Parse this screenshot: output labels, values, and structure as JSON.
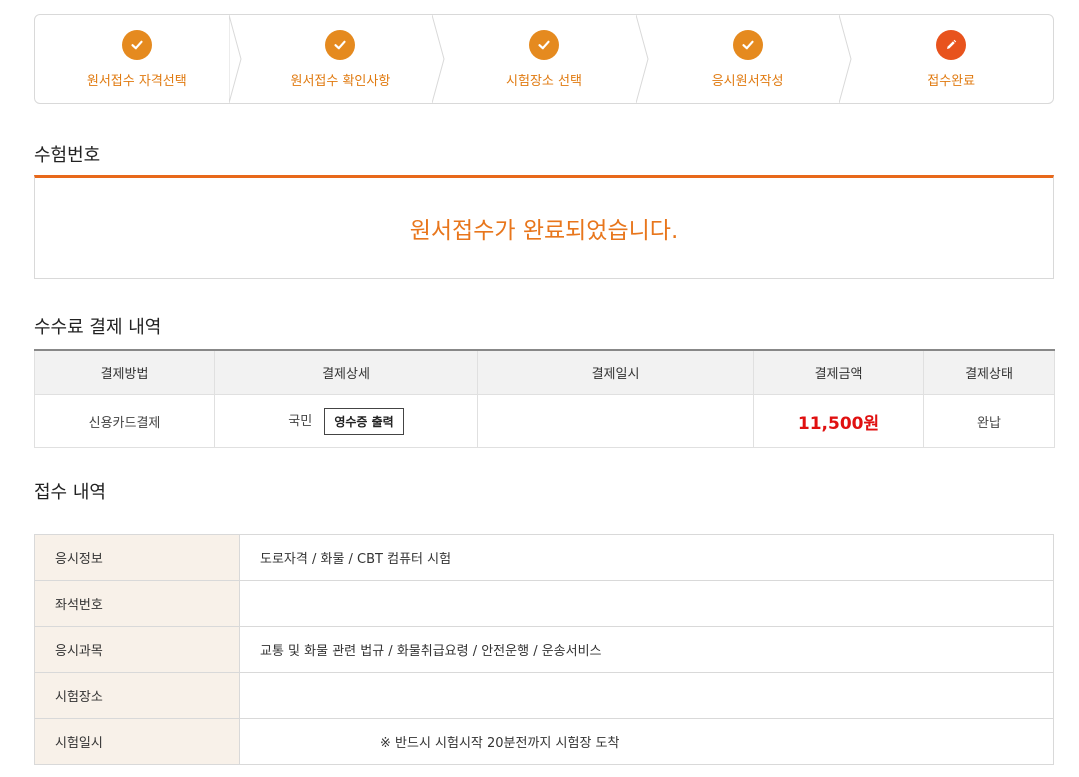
{
  "stepper": {
    "steps": [
      {
        "label": "원서접수 자격선택",
        "icon": "check-icon"
      },
      {
        "label": "원서접수 확인사항",
        "icon": "check-icon"
      },
      {
        "label": "시험장소 선택",
        "icon": "check-icon"
      },
      {
        "label": "응시원서작성",
        "icon": "check-icon"
      },
      {
        "label": "접수완료",
        "icon": "pencil-icon"
      }
    ]
  },
  "exam_number": {
    "title": "수험번호",
    "message": "원서접수가 완료되었습니다."
  },
  "payment": {
    "title": "수수료 결제 내역",
    "headers": [
      "결제방법",
      "결제상세",
      "결제일시",
      "결제금액",
      "결제상태"
    ],
    "row": {
      "method": "신용카드결제",
      "detail": "국민",
      "receipt_button": "영수증 출력",
      "datetime": "",
      "amount": "11,500원",
      "status": "완납"
    }
  },
  "application": {
    "title": "접수 내역",
    "rows": [
      {
        "label": "응시정보",
        "value": "도로자격 / 화물 / CBT 컴퓨터 시험"
      },
      {
        "label": "좌석번호",
        "value": ""
      },
      {
        "label": "응시과목",
        "value": "교통 및 화물 관련 법규 / 화물취급요령 / 안전운행 / 운송서비스"
      },
      {
        "label": "시험장소",
        "value": ""
      },
      {
        "label": "시험일시",
        "value": "※ 반드시 시험시작 20분전까지 시험장 도착"
      }
    ]
  },
  "colors": {
    "accent": "#e8761c",
    "step_done": "#e58a1f",
    "step_active": "#e8531d",
    "amount": "#e01010"
  }
}
